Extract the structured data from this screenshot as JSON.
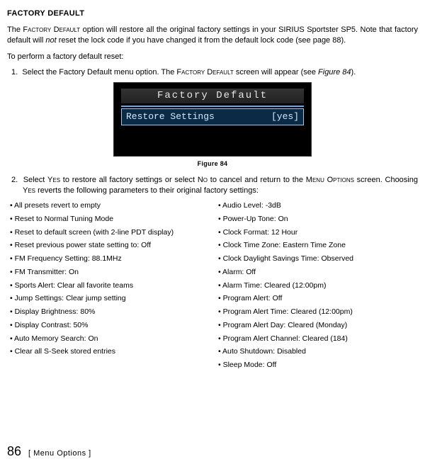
{
  "heading": "FACTORY DEFAULT",
  "intro": {
    "p1a": "The ",
    "p1b": "Factory Default",
    "p1c": " option will restore all the original factory settings in your SIRIUS Sportster SP5. Note that factory default will ",
    "p1d": "not",
    "p1e": " reset the lock code if you have changed it from the default lock code (see page 88).",
    "p2": "To perform a factory default reset:"
  },
  "step1": {
    "num": "1.",
    "a": "Select the Factory Default menu option. The ",
    "b": "Factory Default",
    "c": " screen will appear (see ",
    "d": "Figure 84",
    "e": ")."
  },
  "lcd": {
    "title": "Factory Default",
    "item": "Restore Settings",
    "value": "[yes]"
  },
  "fig_caption": "Figure 84",
  "step2": {
    "num": "2.",
    "a": "Select ",
    "b": "Yes",
    "c": " to restore all factory settings or select ",
    "d": "No",
    "e": " to cancel and return to the ",
    "f": "Menu Options",
    "g": " screen. Choosing ",
    "h": "Yes",
    "i": " reverts the following parameters to their original factory settings:"
  },
  "left_bullets": [
    "All presets revert to empty",
    "Reset to Normal Tuning Mode",
    "Reset to default screen (with 2-line PDT display)",
    "Reset previous power state setting to: Off",
    "FM Frequency Setting: 88.1MHz",
    "FM Transmitter: On",
    "Sports Alert: Clear all favorite teams",
    "Jump Settings: Clear jump setting",
    "Display Brightness: 80%",
    "Display Contrast: 50%",
    "Auto Memory Search: On",
    "Clear all S-Seek stored entries"
  ],
  "right_bullets": [
    "Audio Level: -3dB",
    "Power-Up Tone: On",
    "Clock Format: 12 Hour",
    "Clock Time Zone: Eastern Time Zone",
    "Clock Daylight Savings Time: Observed",
    "Alarm: Off",
    "Alarm Time: Cleared (12:00pm)",
    "Program Alert: Off",
    "Program Alert Time: Cleared (12:00pm)",
    "Program Alert Day: Cleared (Monday)",
    "Program Alert Channel: Cleared (184)",
    "Auto Shutdown: Disabled",
    "Sleep Mode: Off"
  ],
  "footer": {
    "page": "86",
    "section": "[ Menu Options ]"
  }
}
